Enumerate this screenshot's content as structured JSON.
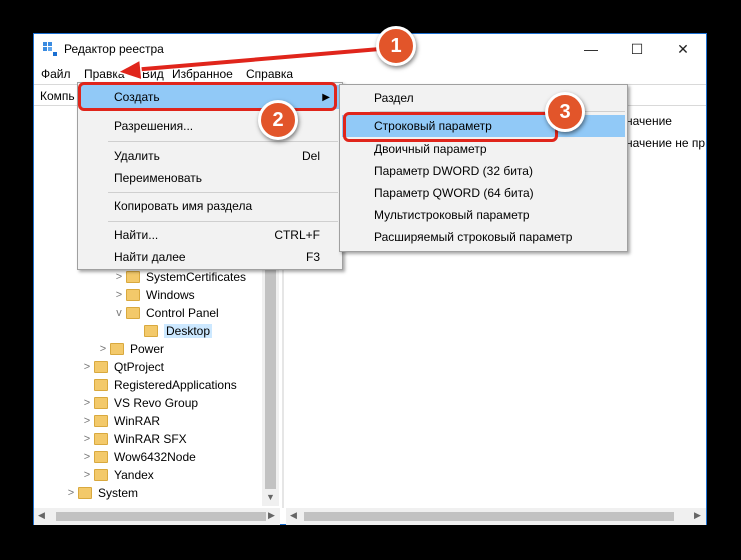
{
  "window": {
    "title": "Редактор реестра",
    "controls": {
      "minimize": "—",
      "maximize": "☐",
      "close": "✕"
    }
  },
  "menubar": {
    "items": [
      "Файл",
      "Правка",
      "Вид",
      "Избранное",
      "Справка"
    ],
    "visible_fragments": {
      "view": "Вид"
    }
  },
  "address": {
    "value": "Компь"
  },
  "tree": {
    "items": [
      {
        "label": "SystemCertificates",
        "chevron": ">"
      },
      {
        "label": "Windows",
        "chevron": ">"
      },
      {
        "label": "Control Panel",
        "chevron": "v"
      },
      {
        "label": "Desktop",
        "chevron": ""
      },
      {
        "label": "Power",
        "chevron": ">"
      },
      {
        "label": "QtProject",
        "chevron": ">"
      },
      {
        "label": "RegisteredApplications",
        "chevron": ""
      },
      {
        "label": "VS Revo Group",
        "chevron": ">"
      },
      {
        "label": "WinRAR",
        "chevron": ">"
      },
      {
        "label": "WinRAR SFX",
        "chevron": ">"
      },
      {
        "label": "Wow6432Node",
        "chevron": ">"
      },
      {
        "label": "Yandex",
        "chevron": ">"
      },
      {
        "label": "System",
        "chevron": ">"
      }
    ],
    "selected": "Desktop"
  },
  "right_pane": {
    "lines": [
      "начение",
      "начение не пр"
    ]
  },
  "edit_menu": {
    "items": [
      {
        "label": "Создать",
        "shortcut": ""
      },
      {
        "label": "Разрешения...",
        "shortcut": ""
      },
      {
        "label": "Удалить",
        "shortcut": "Del"
      },
      {
        "label": "Переименовать",
        "shortcut": ""
      },
      {
        "label": "Копировать имя раздела",
        "shortcut": ""
      },
      {
        "label": "Найти...",
        "shortcut": "CTRL+F"
      },
      {
        "label": "Найти далее",
        "shortcut": "F3"
      }
    ]
  },
  "create_submenu": {
    "items": [
      "Раздел",
      "Строковый параметр",
      "Двоичный параметр",
      "Параметр DWORD (32 бита)",
      "Параметр QWORD (64 бита)",
      "Мультистроковый параметр",
      "Расширяемый строковый параметр"
    ]
  },
  "annotations": {
    "badge1": "1",
    "badge2": "2",
    "badge3": "3"
  },
  "colors": {
    "highlight_red": "#e0251b",
    "badge": "#e2552a",
    "selection": "#91c9f7",
    "accent": "#1b6fd1"
  }
}
